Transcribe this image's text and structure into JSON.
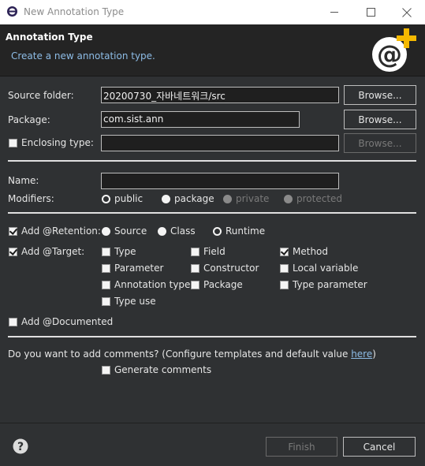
{
  "window": {
    "title": "New Annotation Type"
  },
  "header": {
    "title": "Annotation Type",
    "subtitle": "Create a new annotation type."
  },
  "source_folder": {
    "label": "Source folder:",
    "value": "20200730_자바네트워크/src",
    "browse": "Browse..."
  },
  "package": {
    "label": "Package:",
    "value": "com.sist.ann",
    "browse": "Browse..."
  },
  "enclosing_type": {
    "label": "Enclosing type:",
    "value": "",
    "browse": "Browse...",
    "checked": false
  },
  "name": {
    "label": "Name:",
    "value": ""
  },
  "modifiers": {
    "label": "Modifiers:",
    "options": [
      "public",
      "package",
      "private",
      "protected"
    ],
    "selected": "public"
  },
  "retention": {
    "label": "Add @Retention:",
    "checked": true,
    "options": [
      "Source",
      "Class",
      "Runtime"
    ],
    "selected": "Runtime"
  },
  "target": {
    "label": "Add @Target:",
    "checked": true,
    "options": {
      "type": "Type",
      "field": "Field",
      "method": "Method",
      "parameter": "Parameter",
      "constructor": "Constructor",
      "local_variable": "Local variable",
      "annotation_type": "Annotation type",
      "package": "Package",
      "type_parameter": "Type parameter",
      "type_use": "Type use"
    },
    "checked_options": [
      "Method"
    ]
  },
  "documented": {
    "label": "Add @Documented",
    "checked": false
  },
  "comments": {
    "question": "Do you want to add comments? (Configure templates and default value ",
    "link": "here",
    "close": ")",
    "generate_label": "Generate comments",
    "generate_checked": false
  },
  "footer": {
    "help_icon": "question-mark",
    "finish": "Finish",
    "cancel": "Cancel"
  },
  "colors": {
    "background": "#2f3133",
    "header_bg": "#242424",
    "subtitle": "#8dbce6",
    "link": "#8dbce6",
    "logo_plus": "#f5b900"
  }
}
